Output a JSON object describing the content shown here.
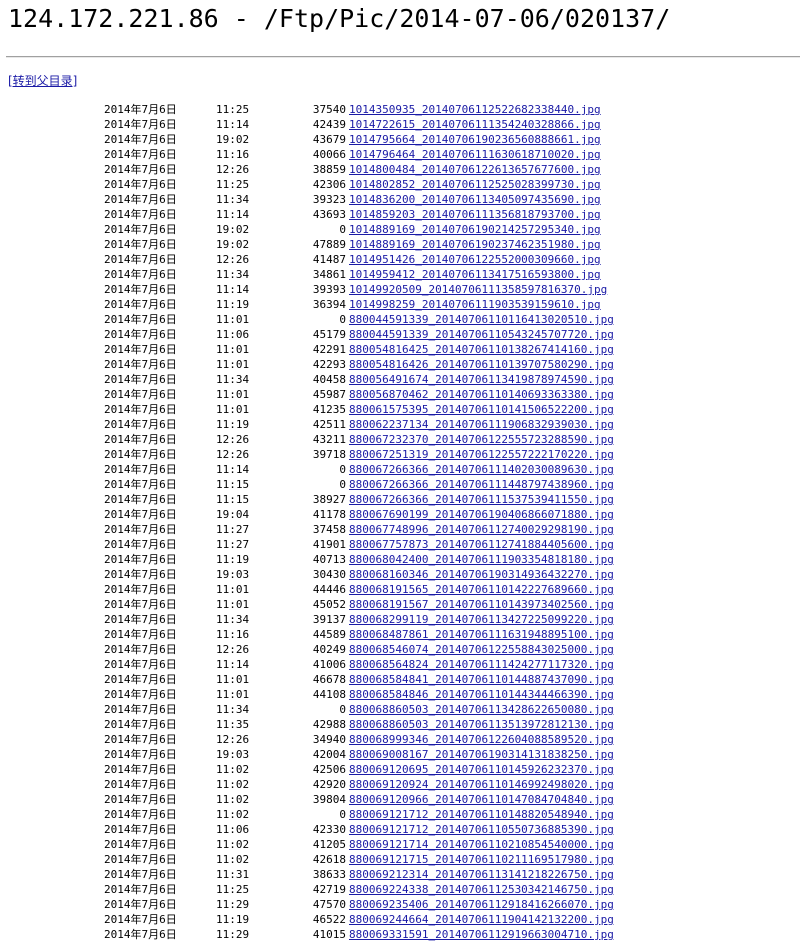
{
  "title": "124.172.221.86 - /Ftp/Pic/2014-07-06/020137/",
  "parent_link": "[转到父目录]",
  "files": [
    {
      "date": "2014年7月6日",
      "time": "11:25",
      "size": "37540",
      "name": "1014350935_20140706112522682338440.jpg"
    },
    {
      "date": "2014年7月6日",
      "time": "11:14",
      "size": "42439",
      "name": "1014722615_20140706111354240328866.jpg"
    },
    {
      "date": "2014年7月6日",
      "time": "19:02",
      "size": "43679",
      "name": "1014795664_20140706190236560888661.jpg"
    },
    {
      "date": "2014年7月6日",
      "time": "11:16",
      "size": "40066",
      "name": "1014796464_20140706111630618710020.jpg"
    },
    {
      "date": "2014年7月6日",
      "time": "12:26",
      "size": "38859",
      "name": "1014800484_20140706122613657677600.jpg"
    },
    {
      "date": "2014年7月6日",
      "time": "11:25",
      "size": "42306",
      "name": "1014802852_20140706112525028399730.jpg"
    },
    {
      "date": "2014年7月6日",
      "time": "11:34",
      "size": "39323",
      "name": "1014836200_20140706113405097435690.jpg"
    },
    {
      "date": "2014年7月6日",
      "time": "11:14",
      "size": "43693",
      "name": "1014859203_20140706111356818793700.jpg"
    },
    {
      "date": "2014年7月6日",
      "time": "19:02",
      "size": "0",
      "name": "1014889169_20140706190214257295340.jpg"
    },
    {
      "date": "2014年7月6日",
      "time": "19:02",
      "size": "47889",
      "name": "1014889169_20140706190237462351980.jpg"
    },
    {
      "date": "2014年7月6日",
      "time": "12:26",
      "size": "41487",
      "name": "1014951426_20140706122552000309660.jpg"
    },
    {
      "date": "2014年7月6日",
      "time": "11:34",
      "size": "34861",
      "name": "1014959412_20140706113417516593800.jpg"
    },
    {
      "date": "2014年7月6日",
      "time": "11:14",
      "size": "39393",
      "name": "10149920509_20140706111358597816370.jpg"
    },
    {
      "date": "2014年7月6日",
      "time": "11:19",
      "size": "36394",
      "name": "1014998259_20140706111903539159610.jpg"
    },
    {
      "date": "2014年7月6日",
      "time": "11:01",
      "size": "0",
      "name": "880044591339_20140706110116413020510.jpg"
    },
    {
      "date": "2014年7月6日",
      "time": "11:06",
      "size": "45179",
      "name": "880044591339_20140706110543245707720.jpg"
    },
    {
      "date": "2014年7月6日",
      "time": "11:01",
      "size": "42291",
      "name": "880054816425_20140706110138267414160.jpg"
    },
    {
      "date": "2014年7月6日",
      "time": "11:01",
      "size": "42293",
      "name": "880054816426_20140706110139707580290.jpg"
    },
    {
      "date": "2014年7月6日",
      "time": "11:34",
      "size": "40458",
      "name": "880056491674_20140706113419878974590.jpg"
    },
    {
      "date": "2014年7月6日",
      "time": "11:01",
      "size": "45987",
      "name": "880056870462_20140706110140693363380.jpg"
    },
    {
      "date": "2014年7月6日",
      "time": "11:01",
      "size": "41235",
      "name": "880061575395_20140706110141506522200.jpg"
    },
    {
      "date": "2014年7月6日",
      "time": "11:19",
      "size": "42511",
      "name": "880062237134_20140706111906832939030.jpg"
    },
    {
      "date": "2014年7月6日",
      "time": "12:26",
      "size": "43211",
      "name": "880067232370_20140706122555723288590.jpg"
    },
    {
      "date": "2014年7月6日",
      "time": "12:26",
      "size": "39718",
      "name": "880067251319_20140706122557222170220.jpg"
    },
    {
      "date": "2014年7月6日",
      "time": "11:14",
      "size": "0",
      "name": "880067266366_20140706111402030089630.jpg"
    },
    {
      "date": "2014年7月6日",
      "time": "11:15",
      "size": "0",
      "name": "880067266366_20140706111448797438960.jpg"
    },
    {
      "date": "2014年7月6日",
      "time": "11:15",
      "size": "38927",
      "name": "880067266366_20140706111537539411550.jpg"
    },
    {
      "date": "2014年7月6日",
      "time": "19:04",
      "size": "41178",
      "name": "880067690199_20140706190406866071880.jpg"
    },
    {
      "date": "2014年7月6日",
      "time": "11:27",
      "size": "37458",
      "name": "880067748996_20140706112740029298190.jpg"
    },
    {
      "date": "2014年7月6日",
      "time": "11:27",
      "size": "41901",
      "name": "880067757873_20140706112741884405600.jpg"
    },
    {
      "date": "2014年7月6日",
      "time": "11:19",
      "size": "40713",
      "name": "880068042400_20140706111903354818180.jpg"
    },
    {
      "date": "2014年7月6日",
      "time": "19:03",
      "size": "30430",
      "name": "880068160346_20140706190314936432270.jpg"
    },
    {
      "date": "2014年7月6日",
      "time": "11:01",
      "size": "44446",
      "name": "880068191565_20140706110142227689660.jpg"
    },
    {
      "date": "2014年7月6日",
      "time": "11:01",
      "size": "45052",
      "name": "880068191567_20140706110143973402560.jpg"
    },
    {
      "date": "2014年7月6日",
      "time": "11:34",
      "size": "39137",
      "name": "880068299119_20140706113427225099220.jpg"
    },
    {
      "date": "2014年7月6日",
      "time": "11:16",
      "size": "44589",
      "name": "880068487861_20140706111631948895100.jpg"
    },
    {
      "date": "2014年7月6日",
      "time": "12:26",
      "size": "40249",
      "name": "880068546074_20140706122558843025000.jpg"
    },
    {
      "date": "2014年7月6日",
      "time": "11:14",
      "size": "41006",
      "name": "880068564824_20140706111424277117320.jpg"
    },
    {
      "date": "2014年7月6日",
      "time": "11:01",
      "size": "46678",
      "name": "880068584841_20140706110144887437090.jpg"
    },
    {
      "date": "2014年7月6日",
      "time": "11:01",
      "size": "44108",
      "name": "880068584846_20140706110144344466390.jpg"
    },
    {
      "date": "2014年7月6日",
      "time": "11:34",
      "size": "0",
      "name": "880068860503_20140706113428622650080.jpg"
    },
    {
      "date": "2014年7月6日",
      "time": "11:35",
      "size": "42988",
      "name": "880068860503_20140706113513972812130.jpg"
    },
    {
      "date": "2014年7月6日",
      "time": "12:26",
      "size": "34940",
      "name": "880068999346_20140706122604088589520.jpg"
    },
    {
      "date": "2014年7月6日",
      "time": "19:03",
      "size": "42004",
      "name": "880069008167_20140706190314131838250.jpg"
    },
    {
      "date": "2014年7月6日",
      "time": "11:02",
      "size": "42506",
      "name": "880069120695_20140706110145926232370.jpg"
    },
    {
      "date": "2014年7月6日",
      "time": "11:02",
      "size": "42920",
      "name": "880069120924_20140706110146992498020.jpg"
    },
    {
      "date": "2014年7月6日",
      "time": "11:02",
      "size": "39804",
      "name": "880069120966_20140706110147084704840.jpg"
    },
    {
      "date": "2014年7月6日",
      "time": "11:02",
      "size": "0",
      "name": "880069121712_20140706110148820548940.jpg"
    },
    {
      "date": "2014年7月6日",
      "time": "11:06",
      "size": "42330",
      "name": "880069121712_20140706110550736885390.jpg"
    },
    {
      "date": "2014年7月6日",
      "time": "11:02",
      "size": "41205",
      "name": "880069121714_20140706110210854540000.jpg"
    },
    {
      "date": "2014年7月6日",
      "time": "11:02",
      "size": "42618",
      "name": "880069121715_20140706110211169517980.jpg"
    },
    {
      "date": "2014年7月6日",
      "time": "11:31",
      "size": "38633",
      "name": "880069212314_20140706113141218226750.jpg"
    },
    {
      "date": "2014年7月6日",
      "time": "11:25",
      "size": "42719",
      "name": "880069224338_20140706112530342146750.jpg"
    },
    {
      "date": "2014年7月6日",
      "time": "11:29",
      "size": "47570",
      "name": "880069235406_20140706112918416266070.jpg"
    },
    {
      "date": "2014年7月6日",
      "time": "11:19",
      "size": "46522",
      "name": "880069244664_20140706111904142132200.jpg"
    },
    {
      "date": "2014年7月6日",
      "time": "11:29",
      "size": "41015",
      "name": "880069331591_20140706112919663004710.jpg"
    }
  ]
}
